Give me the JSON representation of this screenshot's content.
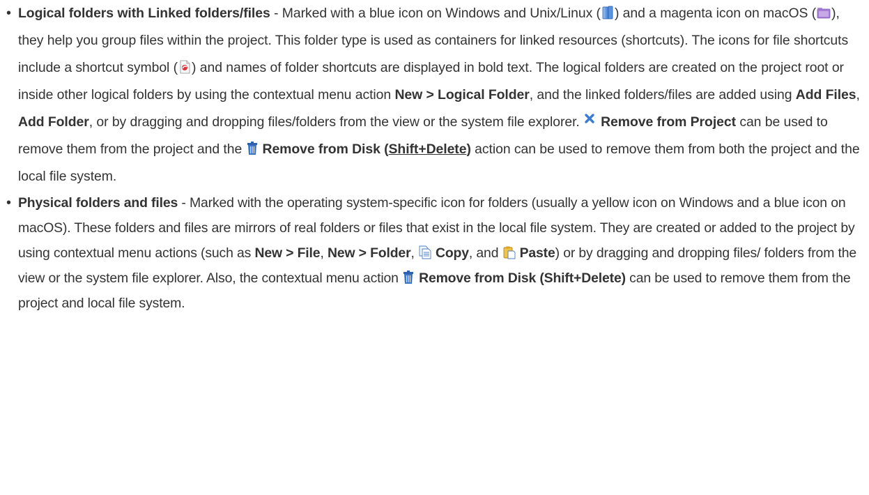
{
  "items": [
    {
      "title": "Logical folders with Linked folders/files",
      "t1": " - Marked with a blue icon on Windows and Unix/Linux (",
      "t2": ") and a magenta icon on macOS (",
      "t3": "), they help you group files within the project. This folder type is used as containers for linked resources (shortcuts). The icons for file shortcuts include a shortcut symbol (",
      "t4": ") and names of folder shortcuts are displayed in bold text. The logical folders are created on the project root or inside other logical folders by using the contextual menu action ",
      "action_new_logical_folder": "New > Logical Folder",
      "t5": ", and the linked folders/files are added using ",
      "action_add_files": "Add Files",
      "t6": ", ",
      "action_add_folder": "Add Folder",
      "t7": ", or by dragging and dropping files/folders from the view or the system file explorer. ",
      "action_remove_from_project": "Remove from Project",
      "t8": " can be used to remove them from the project and the ",
      "action_remove_from_disk": "Remove from Disk (",
      "shortcut_key": "Shift+Delete",
      "action_remove_from_disk_close": ")",
      "t9": " action can be used to remove them from both the project and the local file system."
    },
    {
      "title": "Physical folders and files",
      "t1": " - Marked with the operating system-specific icon for folders (usually a yellow icon on Windows and a blue icon on macOS). These folders and files are mirrors of real folders or files that exist in the local file system. They are created or added to the project by using contextual menu actions (such as ",
      "action_new_file": "New > File",
      "t2": ", ",
      "action_new_folder": "New > Folder",
      "t3": ", ",
      "action_copy": "Copy",
      "t4": ", and ",
      "action_paste": "Paste",
      "t5": ") or by dragging and dropping files/ folders from the view or the system file explorer. Also, the contextual menu action ",
      "action_remove_from_disk": "Remove from Disk (Shift+Delete)",
      "t6": " can be used to remove them from the project and local file system."
    }
  ],
  "icons": {
    "logical_folder_windows": "blue-logical-folder-icon",
    "logical_folder_macos": "magenta-logical-folder-icon",
    "shortcut": "file-shortcut-icon",
    "remove_from_project": "remove-x-icon",
    "remove_from_disk": "trash-icon",
    "copy": "copy-icon",
    "paste": "paste-icon"
  },
  "colors": {
    "text": "#333333",
    "remove_x": "#3a7bd5",
    "trash": "#2d62b0",
    "logical_blue": "#3f7fd8",
    "logical_magenta": "#9a6fcf"
  }
}
